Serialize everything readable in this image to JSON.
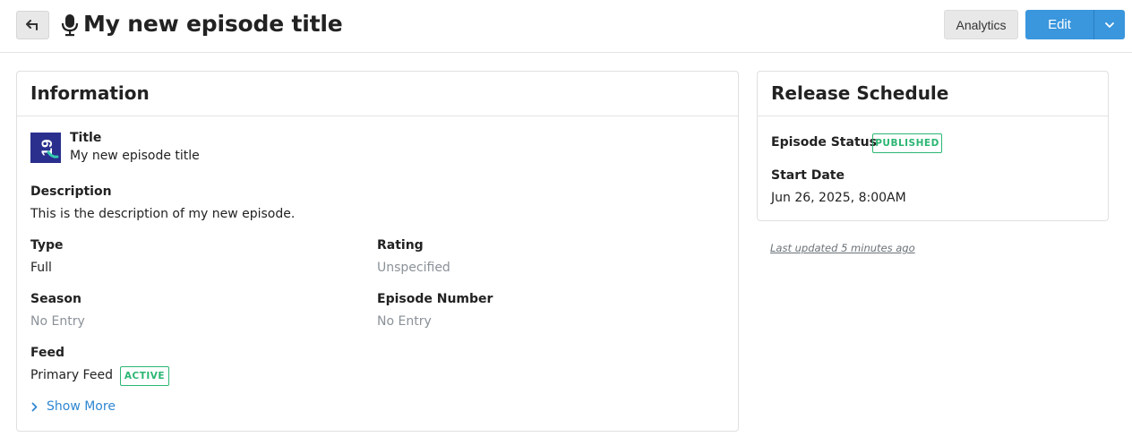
{
  "header": {
    "title": "My new episode title",
    "analytics_label": "Analytics",
    "edit_label": "Edit"
  },
  "information": {
    "heading": "Information",
    "title_label": "Title",
    "title_value": "My new episode title",
    "thumbnail_text": "19",
    "description_label": "Description",
    "description_value": "This is the description of my new episode.",
    "type_label": "Type",
    "type_value": "Full",
    "rating_label": "Rating",
    "rating_value": "Unspecified",
    "season_label": "Season",
    "season_value": "No Entry",
    "episode_number_label": "Episode Number",
    "episode_number_value": "No Entry",
    "feed_label": "Feed",
    "feed_value": "Primary Feed",
    "feed_status": "ACTIVE",
    "show_more": "Show More"
  },
  "release": {
    "heading": "Release Schedule",
    "status_label": "Episode Status",
    "status_value": "PUBLISHED",
    "start_date_label": "Start Date",
    "start_date_value": "Jun 26, 2025, 8:00AM"
  },
  "last_updated": "Last updated 5 minutes ago",
  "colors": {
    "primary": "#3a96dd",
    "success": "#2bb673",
    "link": "#2f87d1",
    "thumbnail_bg": "#2a2f8e"
  },
  "icons": [
    "back-arrow-icon",
    "microphone-icon",
    "chevron-down-icon",
    "chevron-right-icon"
  ]
}
